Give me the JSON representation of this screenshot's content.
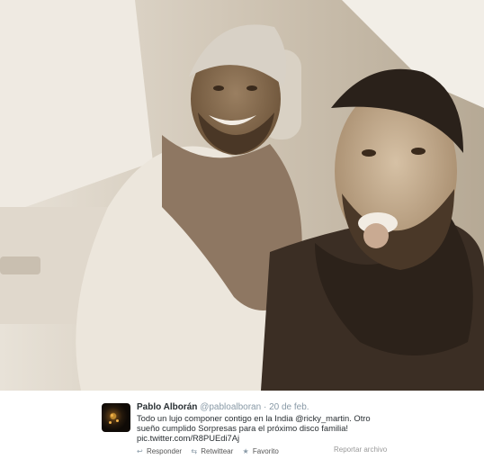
{
  "tweet": {
    "author_name": "Pablo Alborán",
    "author_handle": "@pabloalboran",
    "separator": "·",
    "date": "20 de feb.",
    "text_lines": [
      "Todo un lujo componer contigo en la India @ricky_martin. Otro",
      "sueño cumplido Sorpresas para el próximo disco familia!",
      "pic.twitter.com/R8PUEdi7Aj"
    ],
    "actions": [
      {
        "label": "Responder",
        "icon": "reply-icon",
        "glyph": "↩"
      },
      {
        "label": "Retwittear",
        "icon": "retweet-icon",
        "glyph": "⇆"
      },
      {
        "label": "Favorito",
        "icon": "star-icon",
        "glyph": "★"
      }
    ],
    "report_label": "Reportar archivo"
  },
  "colors": {
    "photo_tone": "#cbbfae",
    "name": "#292f33",
    "meta": "#8899a6"
  }
}
